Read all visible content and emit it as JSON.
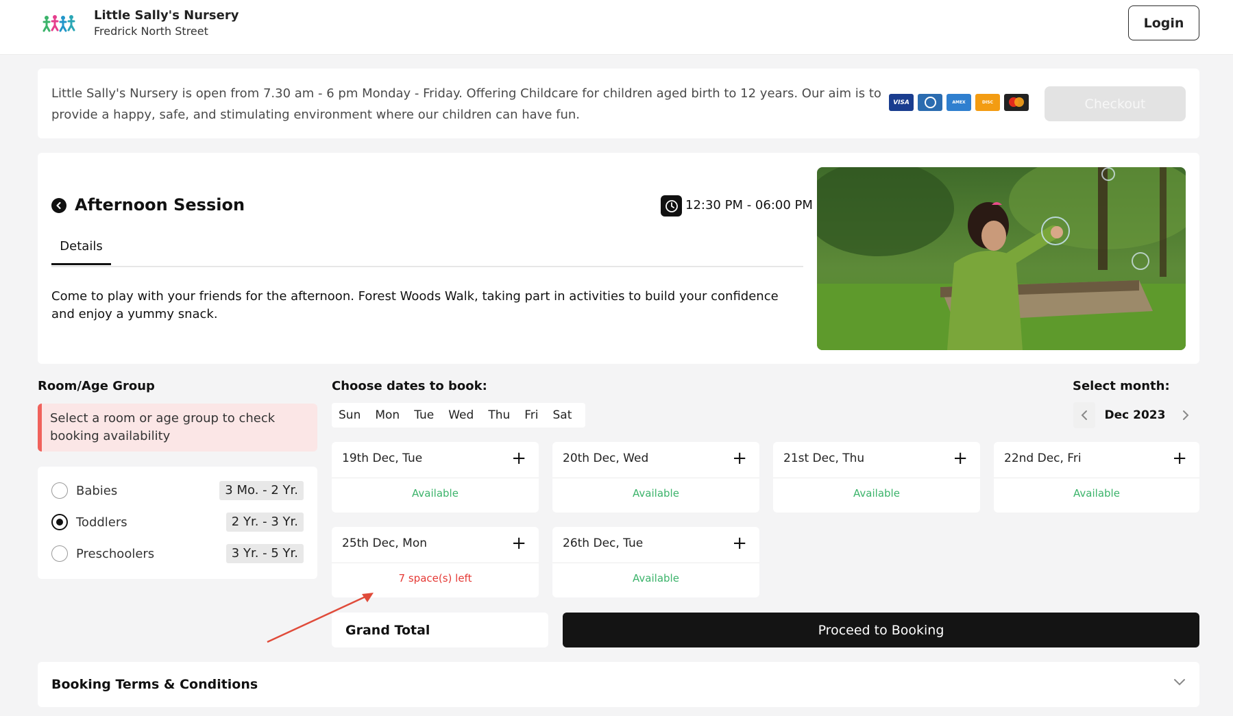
{
  "header": {
    "brand_name": "Little Sally's Nursery",
    "brand_sub": "Fredrick North Street",
    "login_label": "Login"
  },
  "info": {
    "text": "Little Sally's Nursery is open from 7.30 am - 6 pm Monday - Friday. Offering Childcare for children aged birth to 12 years. Our aim is to provide a happy, safe, and stimulating environment where our children can have fun.",
    "payment_icons": [
      "visa-icon",
      "diners-icon",
      "amex-icon",
      "discover-icon",
      "mastercard-icon"
    ],
    "checkout_label": "Checkout"
  },
  "session": {
    "title": "Afternoon Session",
    "time": "12:30 PM - 06:00 PM",
    "tab": "Details",
    "description": "Come to play with your friends for the afternoon. Forest Woods Walk, taking part in activities to build your confidence and enjoy a yummy snack."
  },
  "rooms": {
    "heading": "Room/Age Group",
    "alert": "Select a room or age group to check booking availability",
    "items": [
      {
        "label": "Babies",
        "age": "3 Mo. - 2 Yr.",
        "selected": false
      },
      {
        "label": "Toddlers",
        "age": "2 Yr. - 3 Yr.",
        "selected": true
      },
      {
        "label": "Preschoolers",
        "age": "3 Yr. - 5 Yr.",
        "selected": false
      }
    ]
  },
  "dates": {
    "heading": "Choose dates to book:",
    "days": [
      "Sun",
      "Mon",
      "Tue",
      "Wed",
      "Thu",
      "Fri",
      "Sat"
    ],
    "month_heading": "Select month:",
    "month": "Dec 2023",
    "cards": [
      {
        "label": "19th Dec, Tue",
        "status": "Available"
      },
      {
        "label": "20th Dec, Wed",
        "status": "Available"
      },
      {
        "label": "21st Dec, Thu",
        "status": "Available"
      },
      {
        "label": "22nd Dec, Fri",
        "status": "Available"
      },
      {
        "label": "25th Dec, Mon",
        "status": "7 space(s) left"
      },
      {
        "label": "26th Dec, Tue",
        "status": "Available"
      }
    ]
  },
  "footer": {
    "grand_total": "Grand Total",
    "proceed": "Proceed to Booking",
    "terms": "Booking Terms & Conditions"
  },
  "colors": {
    "available": "#3bb36a",
    "limited": "#e53935",
    "alert_bg": "#fbe6e6",
    "alert_border": "#f0625c",
    "primary": "#141414"
  }
}
